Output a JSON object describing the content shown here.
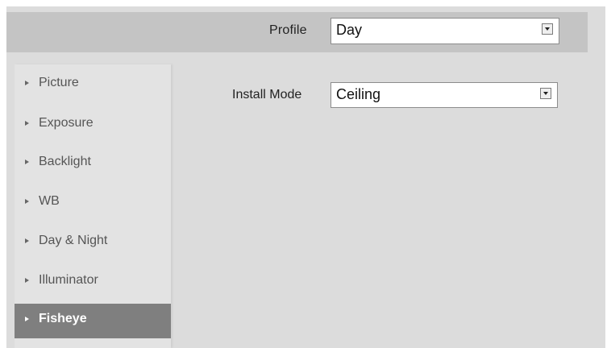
{
  "profile": {
    "label": "Profile",
    "value": "Day"
  },
  "sidebar": {
    "items": [
      {
        "label": "Picture"
      },
      {
        "label": "Exposure"
      },
      {
        "label": "Backlight"
      },
      {
        "label": "WB"
      },
      {
        "label": "Day & Night"
      },
      {
        "label": "Illuminator"
      },
      {
        "label": "Fisheye",
        "selected": true
      }
    ]
  },
  "main": {
    "install_mode_label": "Install Mode",
    "install_mode_value": "Ceiling"
  },
  "icons": {
    "menu_item": "triangle-right-icon",
    "dropdown": "chevron-down-icon"
  },
  "colors": {
    "frame_bg": "#dcdcdc",
    "toolbar_bg": "#c4c4c4",
    "active_item_bg": "#7f7f7f"
  }
}
